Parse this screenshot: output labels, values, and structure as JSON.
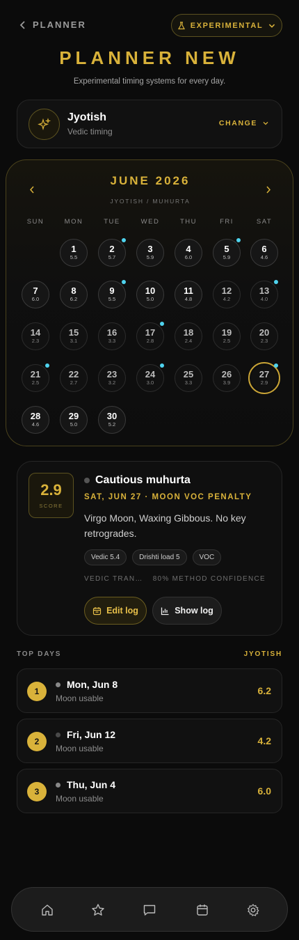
{
  "header": {
    "back_label": "PLANNER",
    "experimental_label": "EXPERIMENTAL",
    "title": "PLANNER NEW",
    "subtitle": "Experimental timing systems for every day."
  },
  "system": {
    "name": "Jyotish",
    "subtitle": "Vedic timing",
    "change_label": "CHANGE"
  },
  "calendar": {
    "month": "JUNE 2026",
    "subtitle": "JYOTISH / MUHURTA",
    "weekdays": [
      "SUN",
      "MON",
      "TUE",
      "WED",
      "THU",
      "FRI",
      "SAT"
    ],
    "start_col": 1,
    "days": [
      {
        "d": "1",
        "s": "5.5",
        "dot": false,
        "dim": false
      },
      {
        "d": "2",
        "s": "5.7",
        "dot": true,
        "dim": false
      },
      {
        "d": "3",
        "s": "5.9",
        "dot": false,
        "dim": false
      },
      {
        "d": "4",
        "s": "6.0",
        "dot": false,
        "dim": false
      },
      {
        "d": "5",
        "s": "5.9",
        "dot": true,
        "dim": false
      },
      {
        "d": "6",
        "s": "4.6",
        "dot": false,
        "dim": false
      },
      {
        "d": "7",
        "s": "6.0",
        "dot": false,
        "dim": false
      },
      {
        "d": "8",
        "s": "6.2",
        "dot": false,
        "dim": false
      },
      {
        "d": "9",
        "s": "5.5",
        "dot": true,
        "dim": false
      },
      {
        "d": "10",
        "s": "5.0",
        "dot": false,
        "dim": false
      },
      {
        "d": "11",
        "s": "4.8",
        "dot": false,
        "dim": false
      },
      {
        "d": "12",
        "s": "4.2",
        "dot": false,
        "dim": true
      },
      {
        "d": "13",
        "s": "4.0",
        "dot": true,
        "dim": true
      },
      {
        "d": "14",
        "s": "2.3",
        "dot": false,
        "dim": true
      },
      {
        "d": "15",
        "s": "3.1",
        "dot": false,
        "dim": true
      },
      {
        "d": "16",
        "s": "3.3",
        "dot": false,
        "dim": true
      },
      {
        "d": "17",
        "s": "2.8",
        "dot": true,
        "dim": true
      },
      {
        "d": "18",
        "s": "2.4",
        "dot": false,
        "dim": true
      },
      {
        "d": "19",
        "s": "2.5",
        "dot": false,
        "dim": true
      },
      {
        "d": "20",
        "s": "2.3",
        "dot": false,
        "dim": true
      },
      {
        "d": "21",
        "s": "2.5",
        "dot": true,
        "dim": true
      },
      {
        "d": "22",
        "s": "2.7",
        "dot": false,
        "dim": true
      },
      {
        "d": "23",
        "s": "3.2",
        "dot": false,
        "dim": true
      },
      {
        "d": "24",
        "s": "3.0",
        "dot": true,
        "dim": true
      },
      {
        "d": "25",
        "s": "3.3",
        "dot": false,
        "dim": true
      },
      {
        "d": "26",
        "s": "3.9",
        "dot": false,
        "dim": true
      },
      {
        "d": "27",
        "s": "2.9",
        "dot": true,
        "dim": true,
        "selected": true
      },
      {
        "d": "28",
        "s": "4.6",
        "dot": false,
        "dim": false
      },
      {
        "d": "29",
        "s": "5.0",
        "dot": false,
        "dim": false
      },
      {
        "d": "30",
        "s": "5.2",
        "dot": false,
        "dim": false
      }
    ]
  },
  "detail": {
    "score": "2.9",
    "score_label": "SCORE",
    "title": "Cautious muhurta",
    "subtitle": "SAT, JUN 27 · MOON VOC PENALTY",
    "description": "Virgo Moon, Waxing Gibbous. No key retrogrades.",
    "tags": [
      "Vedic 5.4",
      "Drishti load 5",
      "VOC"
    ],
    "meta_left": "VEDIC TRAN…",
    "meta_right": "80% METHOD CONFIDENCE",
    "edit_label": "Edit log",
    "show_label": "Show log"
  },
  "top_days": {
    "heading": "TOP DAYS",
    "system": "JYOTISH",
    "items": [
      {
        "rank": "1",
        "date": "Mon, Jun 8",
        "note": "Moon usable",
        "score": "6.2",
        "dot": "light"
      },
      {
        "rank": "2",
        "date": "Fri, Jun 12",
        "note": "Moon usable",
        "score": "4.2",
        "dot": "dark"
      },
      {
        "rank": "3",
        "date": "Thu, Jun 4",
        "note": "Moon usable",
        "score": "6.0",
        "dot": "light"
      }
    ]
  },
  "nav": {
    "items": [
      "home-icon",
      "star-icon",
      "chat-icon",
      "calendar-icon",
      "gear-icon"
    ]
  },
  "colors": {
    "accent": "#d9b23a",
    "dot": "#4fd3ee",
    "background": "#0b0b0b"
  }
}
